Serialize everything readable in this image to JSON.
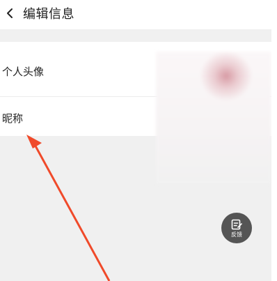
{
  "header": {
    "title": "编辑信息",
    "back_icon": "chevron-left-icon"
  },
  "settings": {
    "rows": [
      {
        "label": "个人头像"
      },
      {
        "label": "昵称"
      }
    ]
  },
  "fab": {
    "label": "反馈",
    "icon": "feedback-edit-icon",
    "color": "#555555"
  },
  "annotation": {
    "color": "#f04a2a",
    "icon": "red-arrow-icon"
  }
}
